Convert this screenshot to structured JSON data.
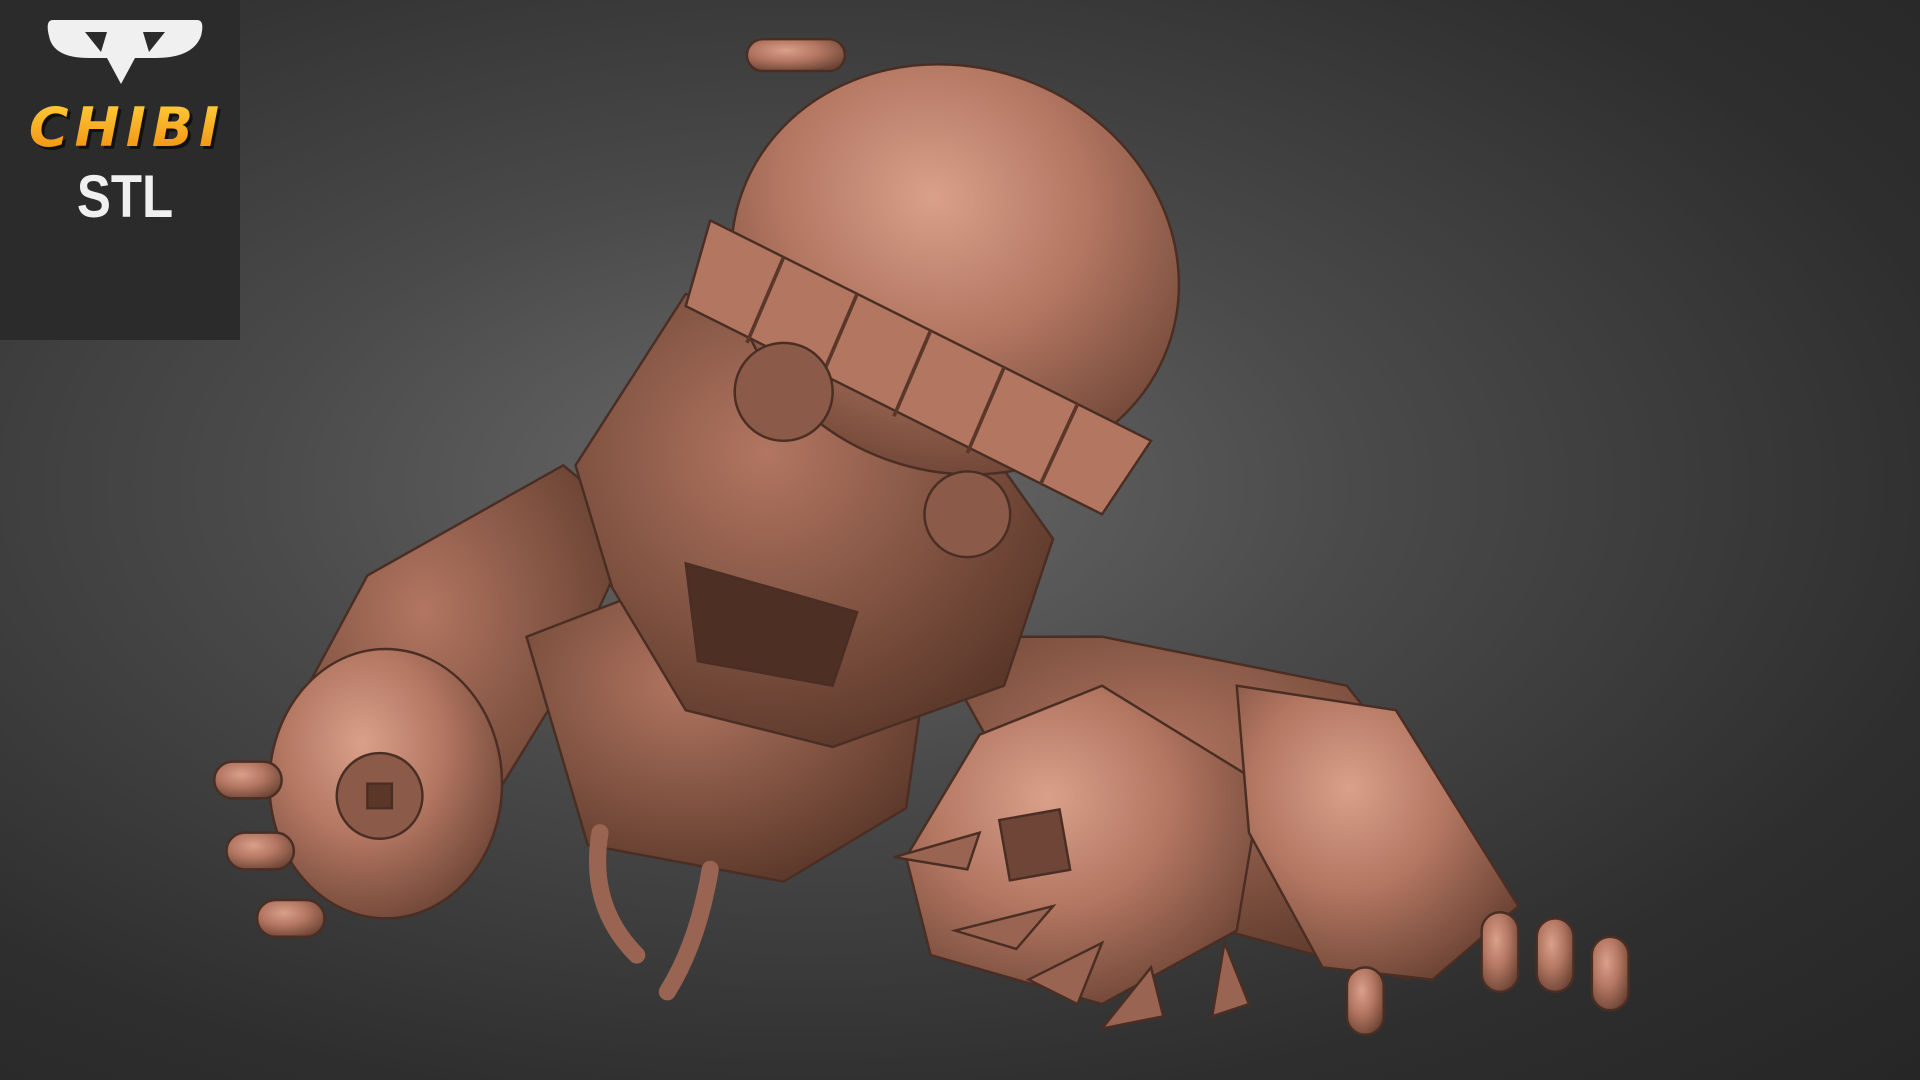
{
  "logo": {
    "brand": "CHIBI",
    "subtitle": "STL",
    "brand_color": "#f5a623"
  },
  "model": {
    "material_color": "#b57a66"
  }
}
